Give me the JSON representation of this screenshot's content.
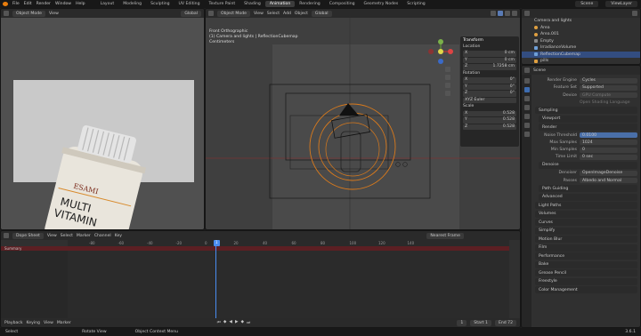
{
  "topbar": {
    "menus": [
      "File",
      "Edit",
      "Render",
      "Window",
      "Help"
    ],
    "tabs": [
      "Layout",
      "Modeling",
      "Sculpting",
      "UV Editing",
      "Texture Paint",
      "Shading",
      "Animation",
      "Rendering",
      "Compositing",
      "Geometry Nodes",
      "Scripting"
    ],
    "active_tab": "Animation",
    "scene": "Scene",
    "view_layer": "ViewLayer"
  },
  "viewport_left": {
    "mode": "Object Mode",
    "menus": [
      "View"
    ],
    "shading": "Global"
  },
  "viewport_right": {
    "mode": "Object Mode",
    "menus": [
      "View",
      "Select",
      "Add",
      "Object"
    ],
    "transform_orientation": "Global",
    "info": [
      "Front Orthographic",
      "(1) Camera and lights | ReflectionCubemap",
      "Centimeters"
    ],
    "npanel": {
      "title": "Transform",
      "location_label": "Location",
      "location": [
        {
          "axis": "X",
          "value": "0 cm"
        },
        {
          "axis": "Y",
          "value": "0 cm"
        },
        {
          "axis": "Z",
          "value": "1.7258 cm"
        }
      ],
      "rotation_label": "Rotation",
      "rotation": [
        {
          "axis": "X",
          "value": "0°"
        },
        {
          "axis": "Y",
          "value": "0°"
        },
        {
          "axis": "Z",
          "value": "0°"
        }
      ],
      "rotation_mode": "XYZ Euler",
      "scale_label": "Scale",
      "scale": [
        {
          "axis": "X",
          "value": "0.528"
        },
        {
          "axis": "Y",
          "value": "0.528"
        },
        {
          "axis": "Z",
          "value": "0.528"
        }
      ]
    }
  },
  "product": {
    "brand": "ESAMI",
    "line1": "MULTI",
    "line2": "VITAMIN"
  },
  "outliner": {
    "items": [
      {
        "name": "Camera and lights",
        "selected": false
      },
      {
        "name": "Area",
        "selected": false
      },
      {
        "name": "Area.001",
        "selected": false
      },
      {
        "name": "Empty",
        "selected": false
      },
      {
        "name": "IrradianceVolume",
        "selected": false
      },
      {
        "name": "ReflectionCubemap",
        "selected": true
      },
      {
        "name": "pills",
        "selected": false
      }
    ]
  },
  "properties": {
    "header": "Scene",
    "render_engine_label": "Render Engine",
    "render_engine": "Cycles",
    "feature_set_label": "Feature Set",
    "feature_set": "Supported",
    "device_label": "Device",
    "device": "GPU Compute",
    "osl_label": "Open Shading Language",
    "sampling": "Sampling",
    "viewport": "Viewport",
    "render": "Render",
    "noise_label": "Noise Threshold",
    "noise": "0.0100",
    "max_samples_label": "Max Samples",
    "max_samples": "1024",
    "min_samples_label": "Min Samples",
    "min_samples": "0",
    "time_limit_label": "Time Limit",
    "time_limit": "0 sec",
    "denoise": "Denoise",
    "denoiser_label": "Denoiser",
    "denoiser": "OpenImageDenoise",
    "passes_label": "Passes",
    "passes": "Albedo and Normal",
    "path_guiding": "Path Guiding",
    "advanced": "Advanced",
    "sections": [
      "Light Paths",
      "Volumes",
      "Curves",
      "Simplify",
      "Motion Blur",
      "Film",
      "Performance",
      "Bake",
      "Grease Pencil",
      "Freestyle",
      "Color Management"
    ]
  },
  "dopesheet": {
    "mode": "Dope Sheet",
    "menus": [
      "View",
      "Select",
      "Marker",
      "Channel",
      "Key"
    ],
    "keying": "Nearest Frame",
    "summary": "Summary",
    "ticks": [
      "-80",
      "-60",
      "-40",
      "-20",
      "0",
      "20",
      "40",
      "60",
      "80",
      "100",
      "120",
      "140"
    ],
    "current_frame": "1",
    "foot": {
      "playback": "Playback",
      "keying": "Keying",
      "view": "View",
      "marker": "Marker",
      "frame": "1",
      "start_label": "Start",
      "start": "1",
      "end_label": "End",
      "end": "72"
    }
  },
  "statusbar": {
    "items": [
      "Select",
      "Rotate View",
      "Object Context Menu"
    ],
    "version": "3.6.1"
  }
}
